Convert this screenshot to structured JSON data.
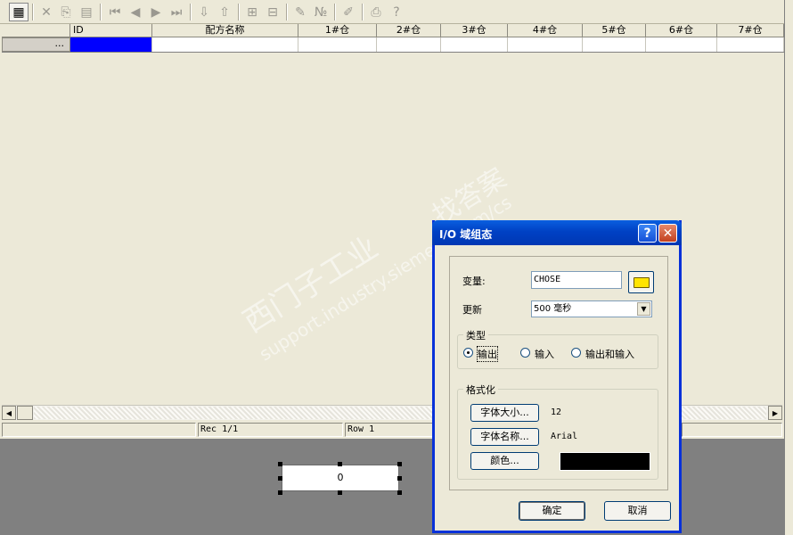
{
  "toolbar": {
    "icons": [
      "table-icon",
      "delete-icon",
      "paste-icon",
      "properties-icon",
      "first-record-icon",
      "previous-record-icon",
      "next-record-icon",
      "last-record-icon",
      "import-icon",
      "export-icon",
      "add-row-icon",
      "remove-row-icon",
      "rename-icon",
      "renumber-icon",
      "edit-icon",
      "print-icon",
      "help-icon"
    ]
  },
  "grid": {
    "columns": [
      "ID",
      "配方名称",
      "1#仓",
      "2#仓",
      "3#仓",
      "4#仓",
      "5#仓",
      "6#仓",
      "7#仓"
    ],
    "row_header": "..."
  },
  "status": {
    "record": "Rec 1/1",
    "row": "Row 1"
  },
  "io_field": {
    "value": "0"
  },
  "dialog": {
    "title": "I/O 域组态",
    "help_label": "?",
    "close_label": "✕",
    "variable_label": "变量:",
    "variable_value": "CHOSE",
    "update_label": "更新",
    "update_value": "500 毫秒",
    "type_group": "类型",
    "radio_output": "输出",
    "radio_input": "输入",
    "radio_io": "输出和输入",
    "format_group": "格式化",
    "font_size_button": "字体大小...",
    "font_size_value": "12",
    "font_name_button": "字体名称...",
    "font_name_value": "Arial",
    "color_button": "颜色...",
    "color_value": "#000000",
    "ok_button": "确定",
    "cancel_button": "取消"
  },
  "watermark": {
    "cn": "西门子工业",
    "cn2": "找答案",
    "url": "support.industry.siemens.com/cs"
  }
}
